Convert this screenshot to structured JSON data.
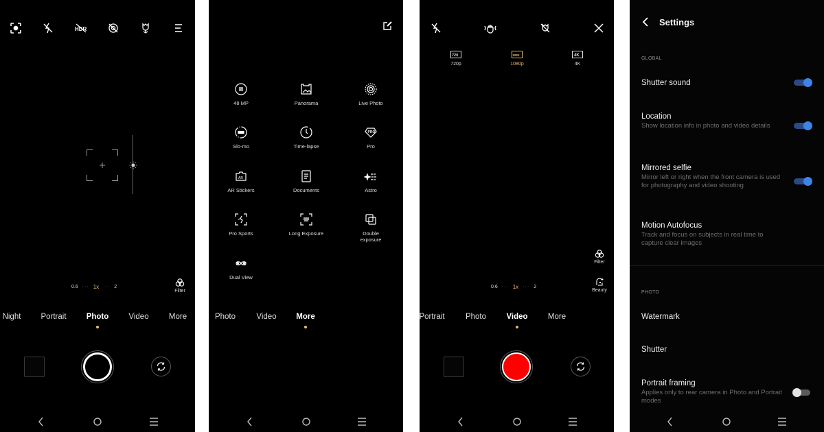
{
  "colors": {
    "accent_gold": "#e8b96a",
    "record_red": "#ff0000",
    "toggle_on": "#3e84e6",
    "toggle_off_knob": "#e4e4e4",
    "background": "#000000"
  },
  "photo_screen": {
    "top_icons": [
      "focus-scan-icon",
      "flash-off-icon",
      "hdr-off-icon",
      "live-off-icon",
      "macro-flower-icon",
      "menu-icon"
    ],
    "zoom_levels": [
      {
        "label": "0.6",
        "active": false
      },
      {
        "label": "1x",
        "active": true
      },
      {
        "label": "2",
        "active": false
      }
    ],
    "filter_label": "Filter",
    "modes": [
      {
        "label": "Night",
        "selected": false
      },
      {
        "label": "Portrait",
        "selected": false
      },
      {
        "label": "Photo",
        "selected": true
      },
      {
        "label": "Video",
        "selected": false
      },
      {
        "label": "More",
        "selected": false
      }
    ]
  },
  "more_screen": {
    "edit_icon": "edit-icon",
    "items": [
      {
        "label": "48 MP",
        "icon": "48mp-icon"
      },
      {
        "label": "Panorama",
        "icon": "panorama-icon"
      },
      {
        "label": "Live Photo",
        "icon": "live-photo-icon"
      },
      {
        "label": "Slo-mo",
        "icon": "slo-mo-icon"
      },
      {
        "label": "Time-lapse",
        "icon": "time-lapse-icon"
      },
      {
        "label": "Pro",
        "icon": "pro-icon"
      },
      {
        "label": "AR Stickers",
        "icon": "ar-stickers-icon"
      },
      {
        "label": "Documents",
        "icon": "documents-icon"
      },
      {
        "label": "Astro",
        "icon": "astro-icon"
      },
      {
        "label": "Pro Sports",
        "icon": "pro-sports-icon"
      },
      {
        "label": "Long Exposure",
        "icon": "long-exposure-icon"
      },
      {
        "label": "Double exposure",
        "icon": "double-exposure-icon"
      },
      {
        "label": "Dual View",
        "icon": "dual-view-icon"
      }
    ],
    "modes": [
      {
        "label": "Photo",
        "selected": false
      },
      {
        "label": "Video",
        "selected": false
      },
      {
        "label": "More",
        "selected": true
      }
    ]
  },
  "video_screen": {
    "top_icons": [
      "flash-off-icon",
      "stabilization-icon",
      "macro-off-icon",
      "close-icon"
    ],
    "resolutions": [
      {
        "label": "720p",
        "badge": "720",
        "active": false
      },
      {
        "label": "1080p",
        "badge": "1080",
        "active": true
      },
      {
        "label": "4K",
        "badge": "4K",
        "active": false
      }
    ],
    "filter_label": "Filter",
    "beauty_label": "Beauty",
    "zoom_levels": [
      {
        "label": "0.6",
        "active": false
      },
      {
        "label": "1x",
        "active": true
      },
      {
        "label": "2",
        "active": false
      }
    ],
    "modes": [
      {
        "label": "Portrait",
        "selected": false
      },
      {
        "label": "Photo",
        "selected": false
      },
      {
        "label": "Video",
        "selected": true
      },
      {
        "label": "More",
        "selected": false
      }
    ]
  },
  "settings_screen": {
    "title": "Settings",
    "sections": [
      {
        "label": "GLOBAL",
        "rows": [
          {
            "title": "Shutter sound",
            "desc": "",
            "toggle": true
          },
          {
            "title": "Location",
            "desc": "Show location info in photo and video details",
            "toggle": true
          },
          {
            "title": "Mirrored selfie",
            "desc": "Mirror left or right when the front camera is used for photography and video shooting",
            "toggle": true
          },
          {
            "title": "Motion Autofocus",
            "desc": "Track and focus on subjects in real time to capture clear images",
            "toggle": null
          }
        ]
      },
      {
        "label": "PHOTO",
        "rows": [
          {
            "title": "Watermark",
            "desc": "",
            "toggle": null
          },
          {
            "title": "Shutter",
            "desc": "",
            "toggle": null
          },
          {
            "title": "Portrait framing",
            "desc": "Applies only to rear camera in Photo and Portrait modes",
            "toggle": false
          }
        ]
      }
    ]
  },
  "navbar": {
    "buttons": [
      "back-icon",
      "home-icon",
      "recents-icon"
    ]
  }
}
